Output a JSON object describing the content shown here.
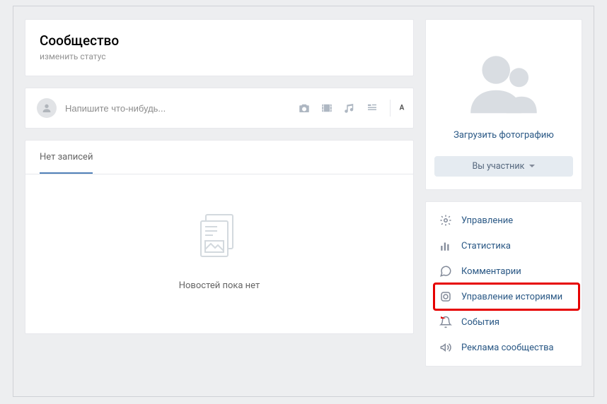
{
  "header": {
    "title": "Сообщество",
    "status_placeholder": "изменить статус"
  },
  "compose": {
    "placeholder": "Напишите что-нибудь..."
  },
  "wall": {
    "tab_label": "Нет записей",
    "empty_text": "Новостей пока нет"
  },
  "sidebar": {
    "upload_photo": "Загрузить фотографию",
    "member_button": "Вы участник"
  },
  "menu": {
    "items": [
      {
        "label": "Управление"
      },
      {
        "label": "Статистика"
      },
      {
        "label": "Комментарии"
      },
      {
        "label": "Управление историями"
      },
      {
        "label": "События"
      },
      {
        "label": "Реклама сообщества"
      }
    ]
  },
  "colors": {
    "link": "#2a5885",
    "highlight": "#e60000"
  }
}
